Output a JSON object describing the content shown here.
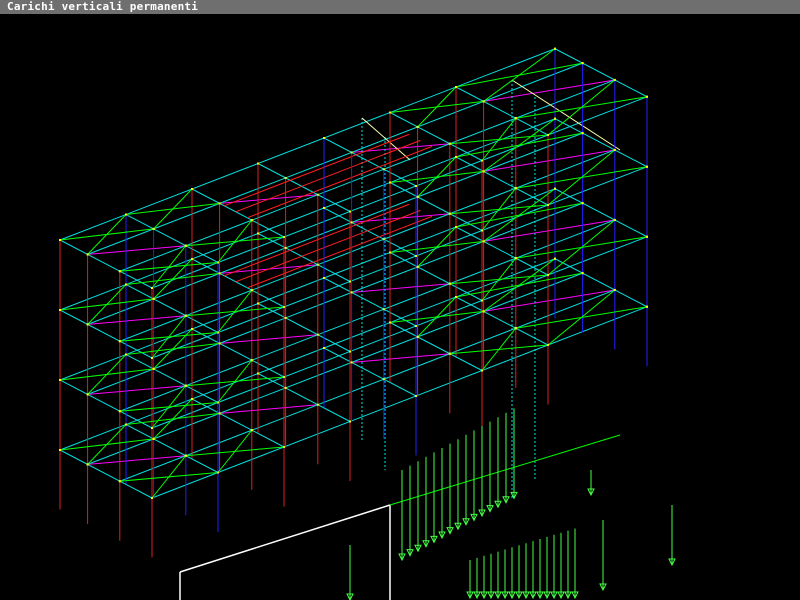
{
  "window": {
    "title": "Carichi verticali permanenti"
  },
  "colors": {
    "background": "#000000",
    "titlebar": "#6f6f6f",
    "title_text": "#ffffff",
    "bracing": "#00ff00",
    "beam": "#00e0e0",
    "column_red": "#dd2020",
    "column_blue": "#2020ff",
    "loaded_beam": "#ff2020",
    "slab_edge": "#ff00ff",
    "node": "#ffff00",
    "load_arrow": "#44ff44",
    "foundation": "#ffffff"
  },
  "icons": {
    "node": "node-point-icon",
    "load": "load-arrow-icon"
  }
}
